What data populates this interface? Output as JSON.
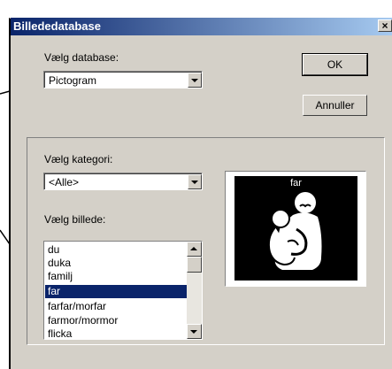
{
  "window": {
    "title": "Billededatabase",
    "close_glyph": "×"
  },
  "database": {
    "label": "Vælg database:",
    "value": "Pictogram"
  },
  "buttons": {
    "ok": "OK",
    "cancel": "Annuller"
  },
  "category": {
    "label": "Vælg kategori:",
    "value": "<Alle>"
  },
  "image": {
    "label": "Vælg billede:",
    "items": [
      "du",
      "duka",
      "familj",
      "far",
      "farfar/morfar",
      "farmor/mormor",
      "flicka"
    ],
    "selected": "far"
  },
  "preview": {
    "caption": "far",
    "icon": "father-and-child-pictogram"
  },
  "colors": {
    "dialog_bg": "#d4d0c8",
    "title_start": "#0a246a",
    "title_end": "#a6caf0",
    "selection": "#0a246a"
  }
}
